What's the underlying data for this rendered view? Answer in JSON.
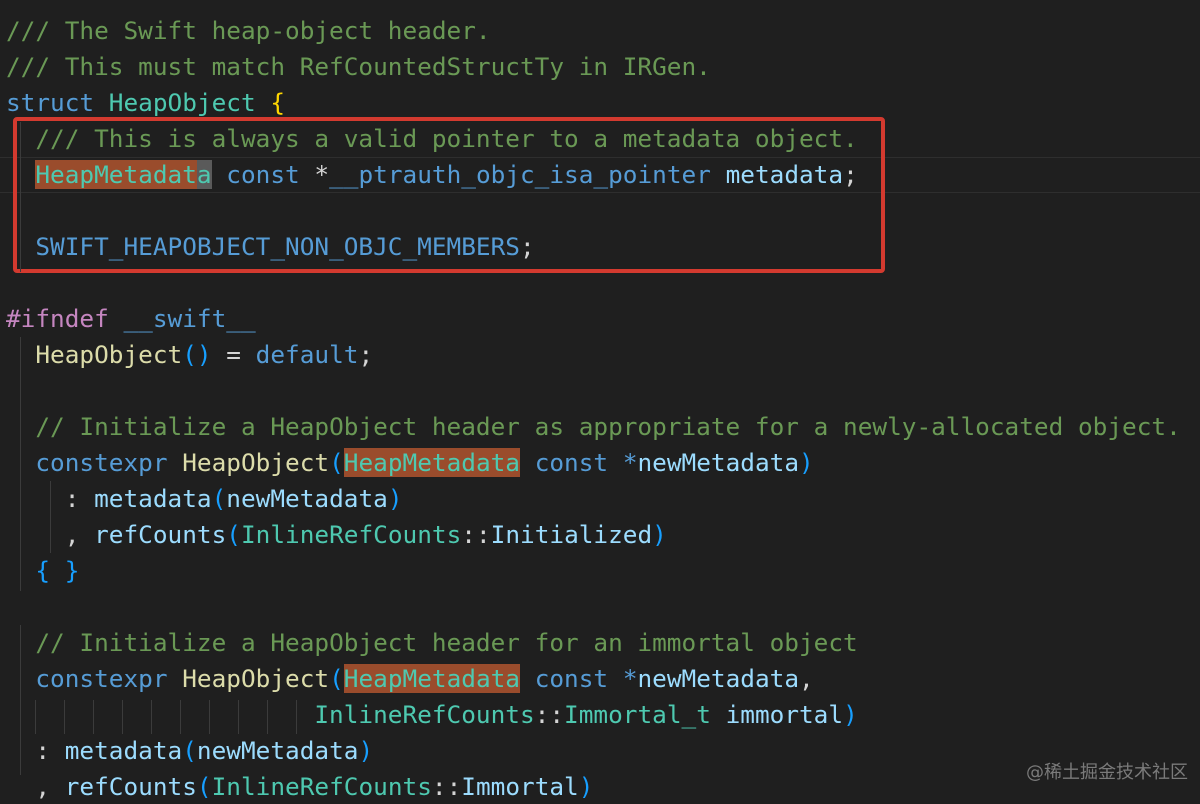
{
  "editor": {
    "lines": [
      {
        "segments": [
          {
            "t": "/// The Swift heap-object header.",
            "c": "comment"
          }
        ]
      },
      {
        "segments": [
          {
            "t": "/// This must match RefCountedStructTy in IRGen.",
            "c": "comment"
          }
        ]
      },
      {
        "segments": [
          {
            "t": "struct",
            "c": "keyword"
          },
          {
            "t": " ",
            "c": "punct"
          },
          {
            "t": "HeapObject",
            "c": "type"
          },
          {
            "t": " ",
            "c": "punct"
          },
          {
            "t": "{",
            "c": "brace-yellow"
          }
        ]
      },
      {
        "segments": [
          {
            "t": "  ",
            "c": "punct"
          },
          {
            "t": "/// This is always a valid pointer to a metadata object.",
            "c": "comment"
          }
        ]
      },
      {
        "segments": [
          {
            "t": "  ",
            "c": "punct"
          },
          {
            "t": "HeapMetadat",
            "c": "type",
            "hl": true
          },
          {
            "t": "a",
            "c": "type",
            "cursor": true
          },
          {
            "t": " ",
            "c": "punct"
          },
          {
            "t": "const",
            "c": "keyword"
          },
          {
            "t": " ",
            "c": "punct"
          },
          {
            "t": "*",
            "c": "punct"
          },
          {
            "t": "__ptrauth_objc_isa_pointer",
            "c": "keyword"
          },
          {
            "t": " ",
            "c": "punct"
          },
          {
            "t": "metadata",
            "c": "var"
          },
          {
            "t": ";",
            "c": "punct"
          }
        ]
      },
      {
        "segments": []
      },
      {
        "segments": [
          {
            "t": "  ",
            "c": "punct"
          },
          {
            "t": "SWIFT_HEAPOBJECT_NON_OBJC_MEMBERS",
            "c": "macro"
          },
          {
            "t": ";",
            "c": "punct"
          }
        ]
      },
      {
        "segments": []
      },
      {
        "segments": [
          {
            "t": "#ifndef",
            "c": "preproc"
          },
          {
            "t": " ",
            "c": "punct"
          },
          {
            "t": "__swift__",
            "c": "macro"
          }
        ]
      },
      {
        "segments": [
          {
            "t": "  ",
            "c": "punct"
          },
          {
            "t": "HeapObject",
            "c": "func"
          },
          {
            "t": "()",
            "c": "paren"
          },
          {
            "t": " = ",
            "c": "punct"
          },
          {
            "t": "default",
            "c": "keyword"
          },
          {
            "t": ";",
            "c": "punct"
          }
        ]
      },
      {
        "segments": []
      },
      {
        "segments": [
          {
            "t": "  ",
            "c": "punct"
          },
          {
            "t": "// Initialize a HeapObject header as appropriate for a newly-allocated object.",
            "c": "comment"
          }
        ]
      },
      {
        "segments": [
          {
            "t": "  ",
            "c": "punct"
          },
          {
            "t": "constexpr",
            "c": "keyword"
          },
          {
            "t": " ",
            "c": "punct"
          },
          {
            "t": "HeapObject",
            "c": "func"
          },
          {
            "t": "(",
            "c": "paren"
          },
          {
            "t": "HeapMetadata",
            "c": "type",
            "hl": true
          },
          {
            "t": " ",
            "c": "punct"
          },
          {
            "t": "const",
            "c": "keyword"
          },
          {
            "t": " ",
            "c": "punct"
          },
          {
            "t": "*",
            "c": "keyword"
          },
          {
            "t": "newMetadata",
            "c": "var"
          },
          {
            "t": ")",
            "c": "paren"
          }
        ]
      },
      {
        "segments": [
          {
            "t": "    ",
            "c": "punct"
          },
          {
            "t": ": ",
            "c": "punct"
          },
          {
            "t": "metadata",
            "c": "var"
          },
          {
            "t": "(",
            "c": "paren"
          },
          {
            "t": "newMetadata",
            "c": "var"
          },
          {
            "t": ")",
            "c": "paren"
          }
        ]
      },
      {
        "segments": [
          {
            "t": "    ",
            "c": "punct"
          },
          {
            "t": ", ",
            "c": "punct"
          },
          {
            "t": "refCounts",
            "c": "var"
          },
          {
            "t": "(",
            "c": "paren"
          },
          {
            "t": "InlineRefCounts",
            "c": "type"
          },
          {
            "t": "::",
            "c": "punct"
          },
          {
            "t": "Initialized",
            "c": "var"
          },
          {
            "t": ")",
            "c": "paren"
          }
        ]
      },
      {
        "segments": [
          {
            "t": "  ",
            "c": "punct"
          },
          {
            "t": "{ }",
            "c": "paren"
          }
        ]
      },
      {
        "segments": []
      },
      {
        "segments": [
          {
            "t": "  ",
            "c": "punct"
          },
          {
            "t": "// Initialize a HeapObject header for an immortal object",
            "c": "comment"
          }
        ]
      },
      {
        "segments": [
          {
            "t": "  ",
            "c": "punct"
          },
          {
            "t": "constexpr",
            "c": "keyword"
          },
          {
            "t": " ",
            "c": "punct"
          },
          {
            "t": "HeapObject",
            "c": "func"
          },
          {
            "t": "(",
            "c": "paren"
          },
          {
            "t": "HeapMetadata",
            "c": "type",
            "hl": true
          },
          {
            "t": " ",
            "c": "punct"
          },
          {
            "t": "const",
            "c": "keyword"
          },
          {
            "t": " ",
            "c": "punct"
          },
          {
            "t": "*",
            "c": "keyword"
          },
          {
            "t": "newMetadata",
            "c": "var"
          },
          {
            "t": ",",
            "c": "punct"
          }
        ]
      },
      {
        "segments": [
          {
            "t": "                     ",
            "c": "punct"
          },
          {
            "t": "InlineRefCounts",
            "c": "type"
          },
          {
            "t": "::",
            "c": "punct"
          },
          {
            "t": "Immortal_t",
            "c": "type"
          },
          {
            "t": " ",
            "c": "punct"
          },
          {
            "t": "immortal",
            "c": "var"
          },
          {
            "t": ")",
            "c": "paren"
          }
        ]
      },
      {
        "segments": [
          {
            "t": "  ",
            "c": "punct"
          },
          {
            "t": ": ",
            "c": "punct"
          },
          {
            "t": "metadata",
            "c": "var"
          },
          {
            "t": "(",
            "c": "paren"
          },
          {
            "t": "newMetadata",
            "c": "var"
          },
          {
            "t": ")",
            "c": "paren"
          }
        ]
      },
      {
        "segments": [
          {
            "t": "  ",
            "c": "punct"
          },
          {
            "t": ", ",
            "c": "punct"
          },
          {
            "t": "refCounts",
            "c": "var"
          },
          {
            "t": "(",
            "c": "paren"
          },
          {
            "t": "InlineRefCounts",
            "c": "type"
          },
          {
            "t": "::",
            "c": "punct"
          },
          {
            "t": "Immortal",
            "c": "var"
          },
          {
            "t": ")",
            "c": "paren"
          }
        ]
      }
    ]
  },
  "colors": {
    "background": "#1f1f1f",
    "comment": "#6a9955",
    "keyword": "#569cd6",
    "type": "#4ec9b0",
    "function": "#dcdcaa",
    "variable": "#9cdcfe",
    "preprocessor": "#c586c0",
    "highlight": "#9a4c2c",
    "annotation_box": "#d33a2f"
  },
  "watermark": {
    "text": "@稀土掘金技术社区"
  }
}
